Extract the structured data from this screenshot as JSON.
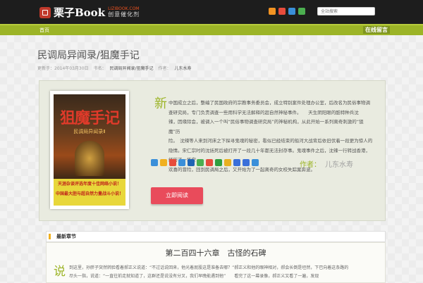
{
  "header": {
    "logo_main": "栗子Book",
    "logo_url": "LIZIBOOK.COM",
    "logo_tagline": "创意催化剂",
    "search_placeholder": "全站搜索",
    "social_icons": [
      {
        "name": "rss-icon",
        "color": "#f29322"
      },
      {
        "name": "weibo-icon",
        "color": "#e74c3c"
      },
      {
        "name": "qq-icon",
        "color": "#3a8fd9"
      },
      {
        "name": "wechat-icon",
        "color": "#4caf50"
      }
    ]
  },
  "nav": {
    "home": "首页",
    "message": "在线留言"
  },
  "page": {
    "title": "民调局异闻录/狙魔手记",
    "meta_date": "更新于：2014年03月30日",
    "meta_category_label": "书名：",
    "meta_category": "民调局异闻录/狙魔手记",
    "meta_author_label": "作者：",
    "meta_author": "儿东水寿"
  },
  "book": {
    "cover_title": "狙魔手记",
    "cover_subtitle": "民调局异闻录Ⅱ",
    "cover_line1": "天涯杂谈评选年度十佳网络小说！",
    "cover_line2": "中国最大胆与超自然力量战斗小说！",
    "dropcap": "新",
    "description": [
      "中国成立之后，整编了民国政府的宗教事务委员会，成立特别案件处理办公室，后改名为民俗事物调",
      "查研究局，专门负责调查一些用科学无法解释的超自然神秘事件。　　天生阴阳眼的酷特种兵沈",
      "辣，因缘际会，被调入一个叫“民俗事物调查研究局”的神秘机构，从此开始一系列离奇刺激的“狙魔”历",
      "险。　沈辣等人来到河床之下探寻鬼魂的秘密，看似已经结束的船河大战背后依旧伏着一段更为惊人的",
      "隐情。宋仁宗时的沈括死后被打开了一段几十年都无法封存事。鬼魂事件之后，沈辣一行转战香港，经历了一场空",
      "欢喜的冒险，回到民调局之后，又开始为了一起离奇的女校失踪案奔波。"
    ],
    "author_label": "作者：",
    "author_name": "儿东水寿",
    "share_icons": [
      {
        "name": "share-plus-icon",
        "color": "#3a8fd9"
      },
      {
        "name": "qzone-icon",
        "color": "#f0b020"
      },
      {
        "name": "weibo-share-icon",
        "color": "#e74c3c"
      },
      {
        "name": "tencent-weibo-icon",
        "color": "#3a8fd9"
      },
      {
        "name": "renren-icon",
        "color": "#1f64b4"
      },
      {
        "name": "wechat-share-icon",
        "color": "#4caf50"
      },
      {
        "name": "kaixin-icon",
        "color": "#e74c3c"
      },
      {
        "name": "douban-icon",
        "color": "#2f9e3f"
      },
      {
        "name": "sohu-icon",
        "color": "#e8b020"
      },
      {
        "name": "tieba-icon",
        "color": "#3a6fd9"
      },
      {
        "name": "baidu-icon",
        "color": "#3a6fd9"
      },
      {
        "name": "qq-share-icon",
        "color": "#3a8fd9"
      }
    ],
    "read_button": "立即阅读"
  },
  "latest": {
    "heading": "最新章节",
    "chapter_title": "第二百四十六章　古怪的石碑",
    "chapter_dropcap": "说",
    "chapter_lines": [
      "到这里，孙胖子突然转脸看着郝正义说道：“不过话说回来，他光着屁股这是准备去哪？”郝正义和他的眼神相对，郝会长倒是坦然，下巴向着这条路的",
      "尽头一指，说道：“一直往前走就知道了，这群还是说没有分叉，我们早晚能遇到他”　　看完了这一幕录像，郝正义又看了一遍，发现"
    ]
  }
}
